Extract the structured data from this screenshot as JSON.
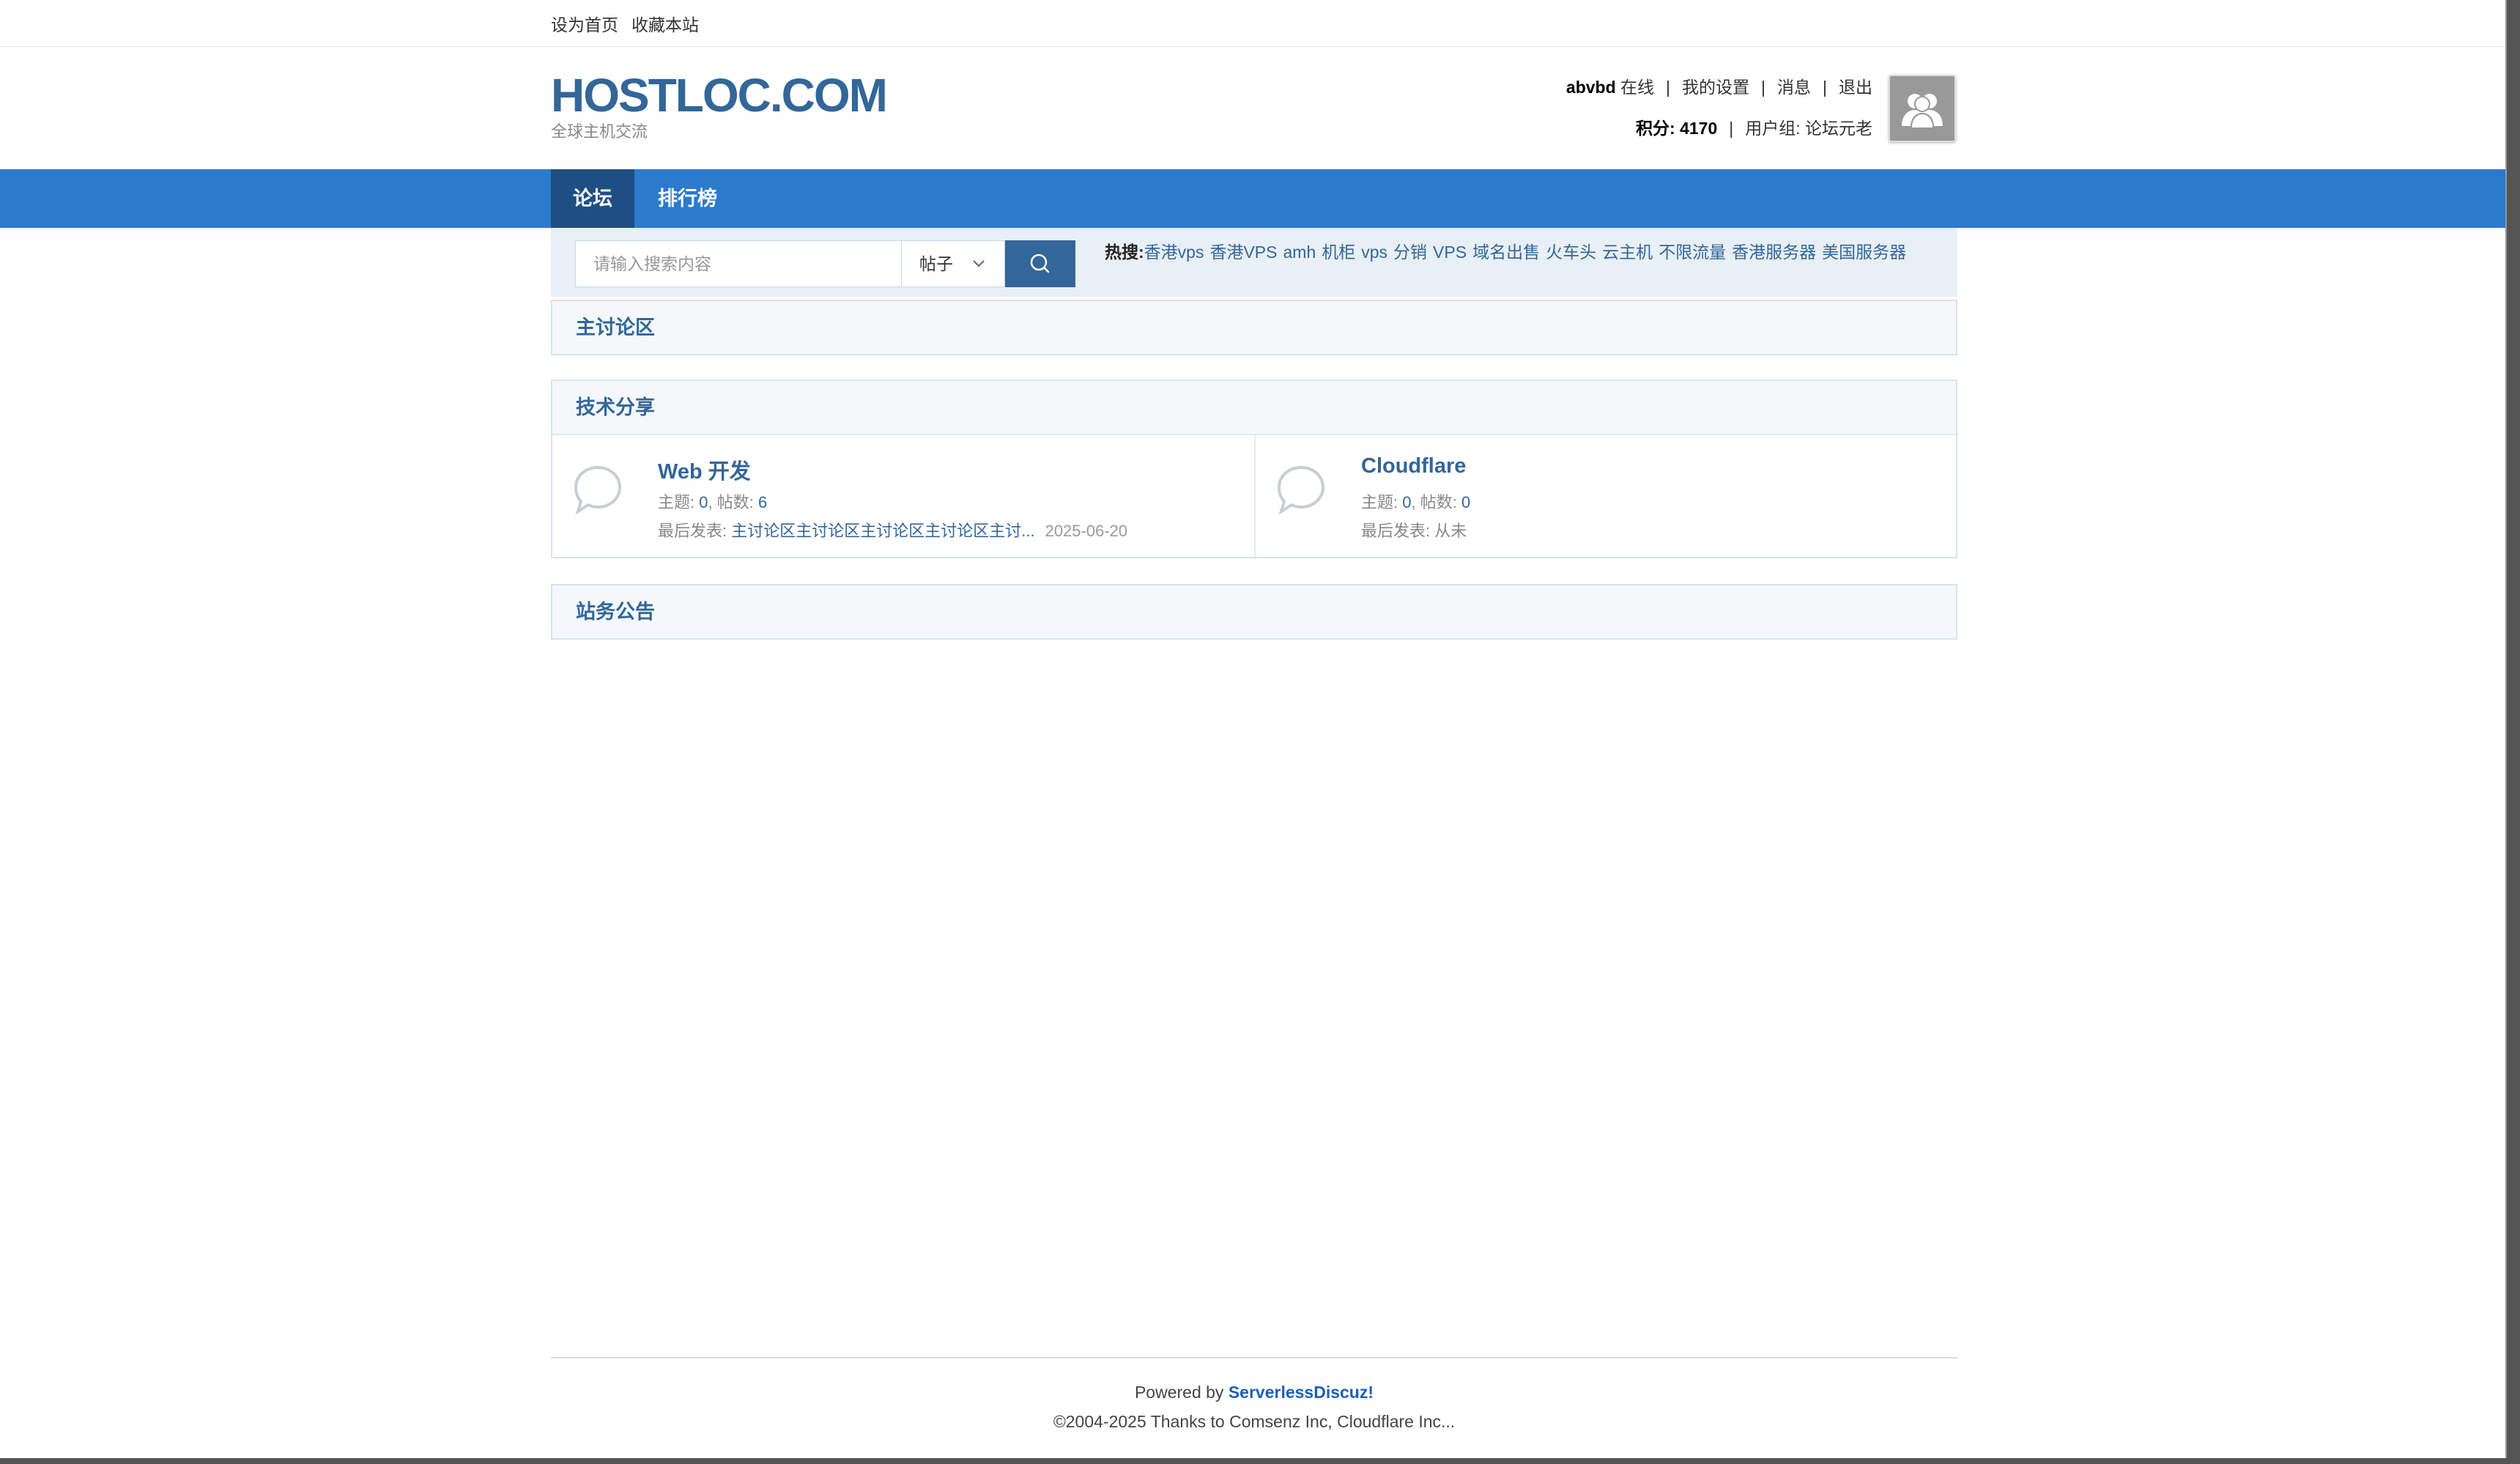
{
  "topbar": {
    "set_home": "设为首页",
    "bookmark": "收藏本站"
  },
  "header": {
    "logo_title": "HOSTLOC.COM",
    "logo_sub": "全球主机交流",
    "username": "abvbd",
    "online": "在线",
    "settings": "我的设置",
    "messages": "消息",
    "logout": "退出",
    "points_label": "积分: 4170",
    "usergroup": "用户组: 论坛元老",
    "avatar_icon": "user-silhouette-icon"
  },
  "nav": {
    "items": [
      {
        "label": "论坛",
        "active": true
      },
      {
        "label": "排行榜",
        "active": false
      }
    ]
  },
  "search": {
    "placeholder": "请输入搜索内容",
    "type": "帖子",
    "button_icon": "search-icon",
    "hot_label": "热搜:",
    "hot": [
      "香港vps",
      "香港VPS",
      "amh",
      "机柜",
      "vps",
      "分销",
      "VPS",
      "域名出售",
      "火车头",
      "云主机",
      "不限流量",
      "香港服务器",
      "美国服务器"
    ]
  },
  "sections": [
    {
      "title": "主讨论区"
    },
    {
      "title": "技术分享",
      "forums": [
        {
          "name": "Web 开发",
          "topics_label": "主题: ",
          "topics": "0",
          "posts_label": "帖数: ",
          "posts": "6",
          "last_label": "最后发表: ",
          "last_title": "主讨论区主讨论区主讨论区主讨论区主讨...",
          "last_date": "2025-06-20"
        },
        {
          "name": "Cloudflare",
          "topics_label": "主题: ",
          "topics": "0",
          "posts_label": "帖数: ",
          "posts": "0",
          "last_label": "最后发表: ",
          "last_never": "从未"
        }
      ]
    },
    {
      "title": "站务公告"
    }
  ],
  "footer": {
    "powered_by": "Powered by ",
    "brand": "ServerlessDiscuz!",
    "copyright": "©2004-2025 Thanks to Comsenz Inc, Cloudflare Inc..."
  },
  "colors": {
    "nav": "#2b7acc",
    "nav_active": "#1d4f82",
    "link": "#336699"
  }
}
